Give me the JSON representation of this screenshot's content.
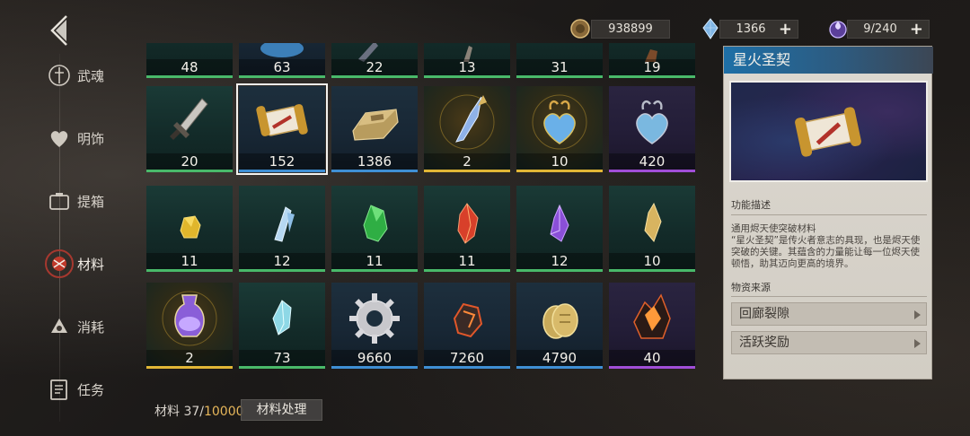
{
  "sidebar": {
    "items": [
      {
        "label": "武魂",
        "icon": "soul-icon"
      },
      {
        "label": "明饰",
        "icon": "heart-ornament-icon"
      },
      {
        "label": "提箱",
        "icon": "box-icon"
      },
      {
        "label": "材料",
        "icon": "materials-icon"
      },
      {
        "label": "消耗",
        "icon": "consumable-icon"
      },
      {
        "label": "任务",
        "icon": "task-icon"
      }
    ]
  },
  "currency": {
    "gold": "938899",
    "crystal": "1366",
    "stamina": "9/240",
    "plus": "+"
  },
  "grid": {
    "rows": [
      [
        {
          "count": "48",
          "rarity": "green"
        },
        {
          "count": "63",
          "rarity": "green"
        },
        {
          "count": "22",
          "rarity": "green"
        },
        {
          "count": "13",
          "rarity": "green"
        },
        {
          "count": "31",
          "rarity": "green"
        },
        {
          "count": "19",
          "rarity": "green"
        }
      ],
      [
        {
          "count": "20",
          "rarity": "green",
          "icon": "dagger-icon"
        },
        {
          "count": "152",
          "rarity": "blue",
          "icon": "scroll-icon",
          "selected": true
        },
        {
          "count": "1386",
          "rarity": "blue",
          "icon": "ingot-icon"
        },
        {
          "count": "2",
          "rarity": "gold",
          "icon": "crystal-shard-icon"
        },
        {
          "count": "10",
          "rarity": "gold",
          "icon": "heart-gem-icon"
        },
        {
          "count": "420",
          "rarity": "purple",
          "icon": "heart-gem-icon"
        }
      ],
      [
        {
          "count": "11",
          "rarity": "green",
          "icon": "gold-ore-icon"
        },
        {
          "count": "12",
          "rarity": "green",
          "icon": "ice-crystal-icon"
        },
        {
          "count": "11",
          "rarity": "green",
          "icon": "emerald-icon"
        },
        {
          "count": "11",
          "rarity": "green",
          "icon": "ruby-icon"
        },
        {
          "count": "12",
          "rarity": "green",
          "icon": "amethyst-icon"
        },
        {
          "count": "10",
          "rarity": "green",
          "icon": "topaz-icon"
        }
      ],
      [
        {
          "count": "2",
          "rarity": "gold",
          "icon": "potion-icon"
        },
        {
          "count": "73",
          "rarity": "green",
          "icon": "aqua-crystal-icon"
        },
        {
          "count": "9660",
          "rarity": "blue",
          "icon": "gear-icon"
        },
        {
          "count": "7260",
          "rarity": "blue",
          "icon": "lava-rock-icon"
        },
        {
          "count": "4790",
          "rarity": "blue",
          "icon": "gold-coin-icon"
        },
        {
          "count": "40",
          "rarity": "purple",
          "icon": "fire-crystal-icon"
        }
      ]
    ]
  },
  "footer": {
    "material_prefix": "材料 37/",
    "material_max": "10000",
    "process_button": "材料处理"
  },
  "detail": {
    "title": "星火圣契",
    "function_heading": "功能描述",
    "description": "通用烬天使突破材料\n“星火圣契”是传火者意志的具现，也是烬天使突破的关键。其蕴含的力量能让每一位烬天使顿悟，助其迈向更高的境界。",
    "source_heading": "物资来源",
    "sources": [
      "回廊裂隙",
      "活跃奖励"
    ]
  },
  "colors": {
    "rarity_green": "#49b96a",
    "rarity_blue": "#3f8fd4",
    "rarity_gold": "#e1b636",
    "rarity_purple": "#a14ed8",
    "title_blue": "#1e6fa6"
  }
}
